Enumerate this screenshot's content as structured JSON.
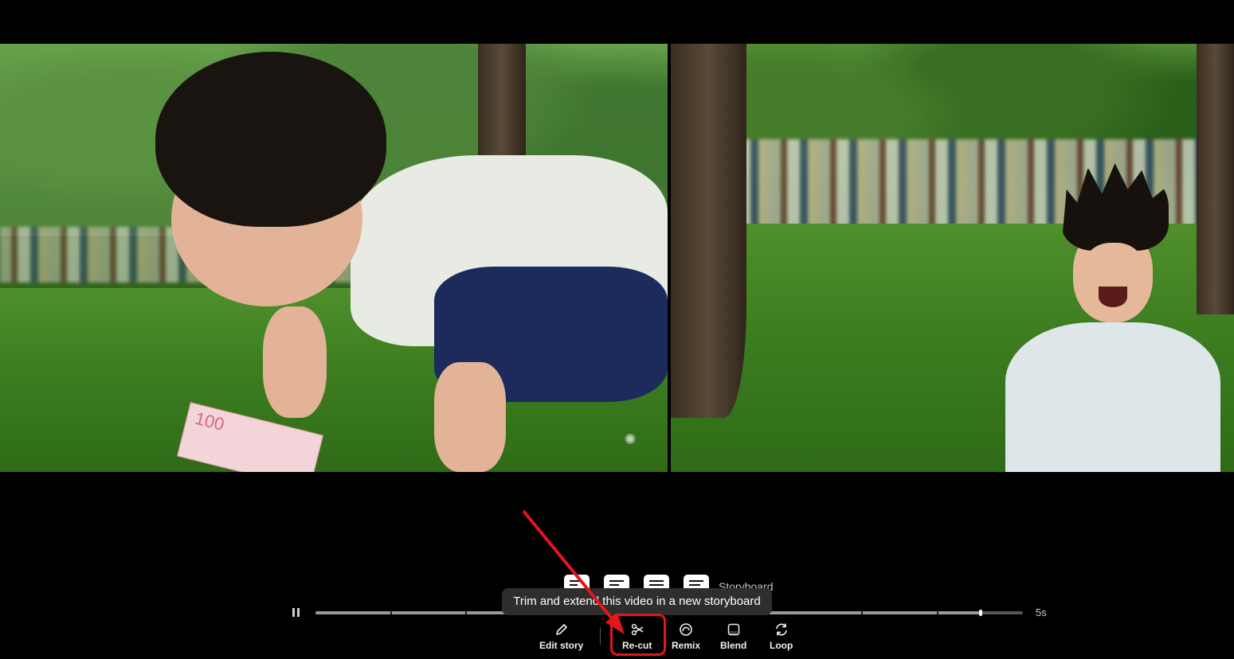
{
  "video": {
    "left_frame": {
      "watermark_icon": "openai-logo-icon",
      "banknote_text": "100"
    },
    "right_frame": {}
  },
  "storyboard": {
    "label": "Storyboard"
  },
  "tooltip": {
    "text": "Trim and extend this video in a new storyboard"
  },
  "timeline": {
    "duration": "5s",
    "playhead_fraction": 0.94,
    "play_state_icon": "pause-icon"
  },
  "toolbar": {
    "edit_story": {
      "label": "Edit story",
      "icon": "pencil-icon"
    },
    "recut": {
      "label": "Re-cut",
      "icon": "scissors-icon"
    },
    "remix": {
      "label": "Remix",
      "icon": "remix-icon"
    },
    "blend": {
      "label": "Blend",
      "icon": "blend-icon"
    },
    "loop": {
      "label": "Loop",
      "icon": "loop-icon"
    }
  },
  "annotation": {
    "highlight_color": "#e3161b",
    "arrow_color": "#e3161b"
  }
}
